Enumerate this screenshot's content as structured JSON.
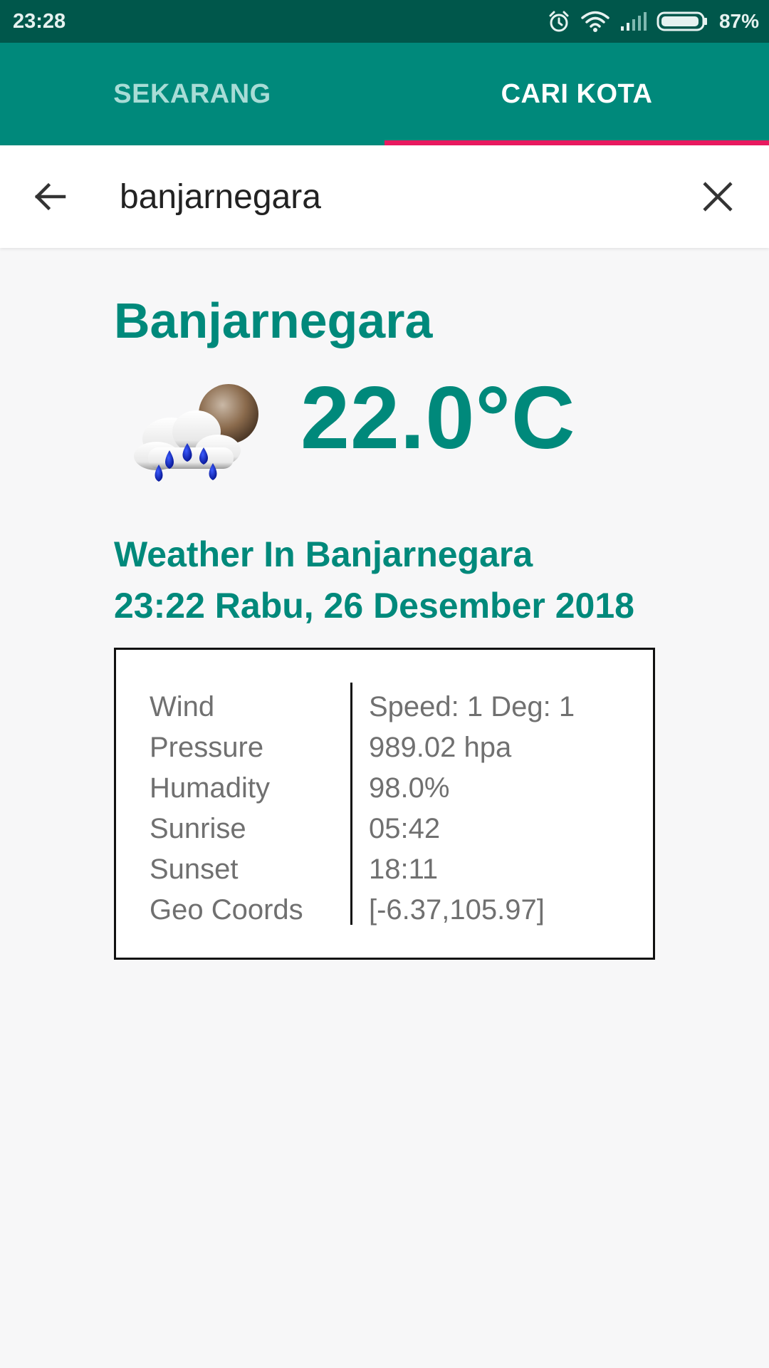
{
  "status_bar": {
    "time": "23:28",
    "battery": "87%",
    "icons": [
      "alarm-icon",
      "wifi-icon",
      "signal-icon",
      "battery-icon"
    ]
  },
  "tabs": [
    {
      "label": "SEKARANG",
      "active": false
    },
    {
      "label": "CARI KOTA",
      "active": true
    }
  ],
  "search": {
    "value": "banjarnegara",
    "back_icon": "arrow-back-icon",
    "clear_icon": "close-icon"
  },
  "weather": {
    "city": "Banjarnegara",
    "temperature": "22.0°C",
    "icon": "rain-cloud-moon-icon",
    "heading_line1": "Weather In Banjarnegara",
    "heading_line2": "23:22 Rabu, 26 Desember 2018"
  },
  "details": [
    {
      "label": "Wind",
      "value": "Speed: 1 Deg: 1"
    },
    {
      "label": "Pressure",
      "value": "989.02 hpa"
    },
    {
      "label": "Humadity",
      "value": "98.0%"
    },
    {
      "label": "Sunrise",
      "value": "05:42"
    },
    {
      "label": "Sunset",
      "value": "18:11"
    },
    {
      "label": "Geo Coords",
      "value": "[-6.37,105.97]"
    }
  ],
  "colors": {
    "primary": "#00897b",
    "primary_dark": "#00574b",
    "accent": "#e8195f"
  }
}
